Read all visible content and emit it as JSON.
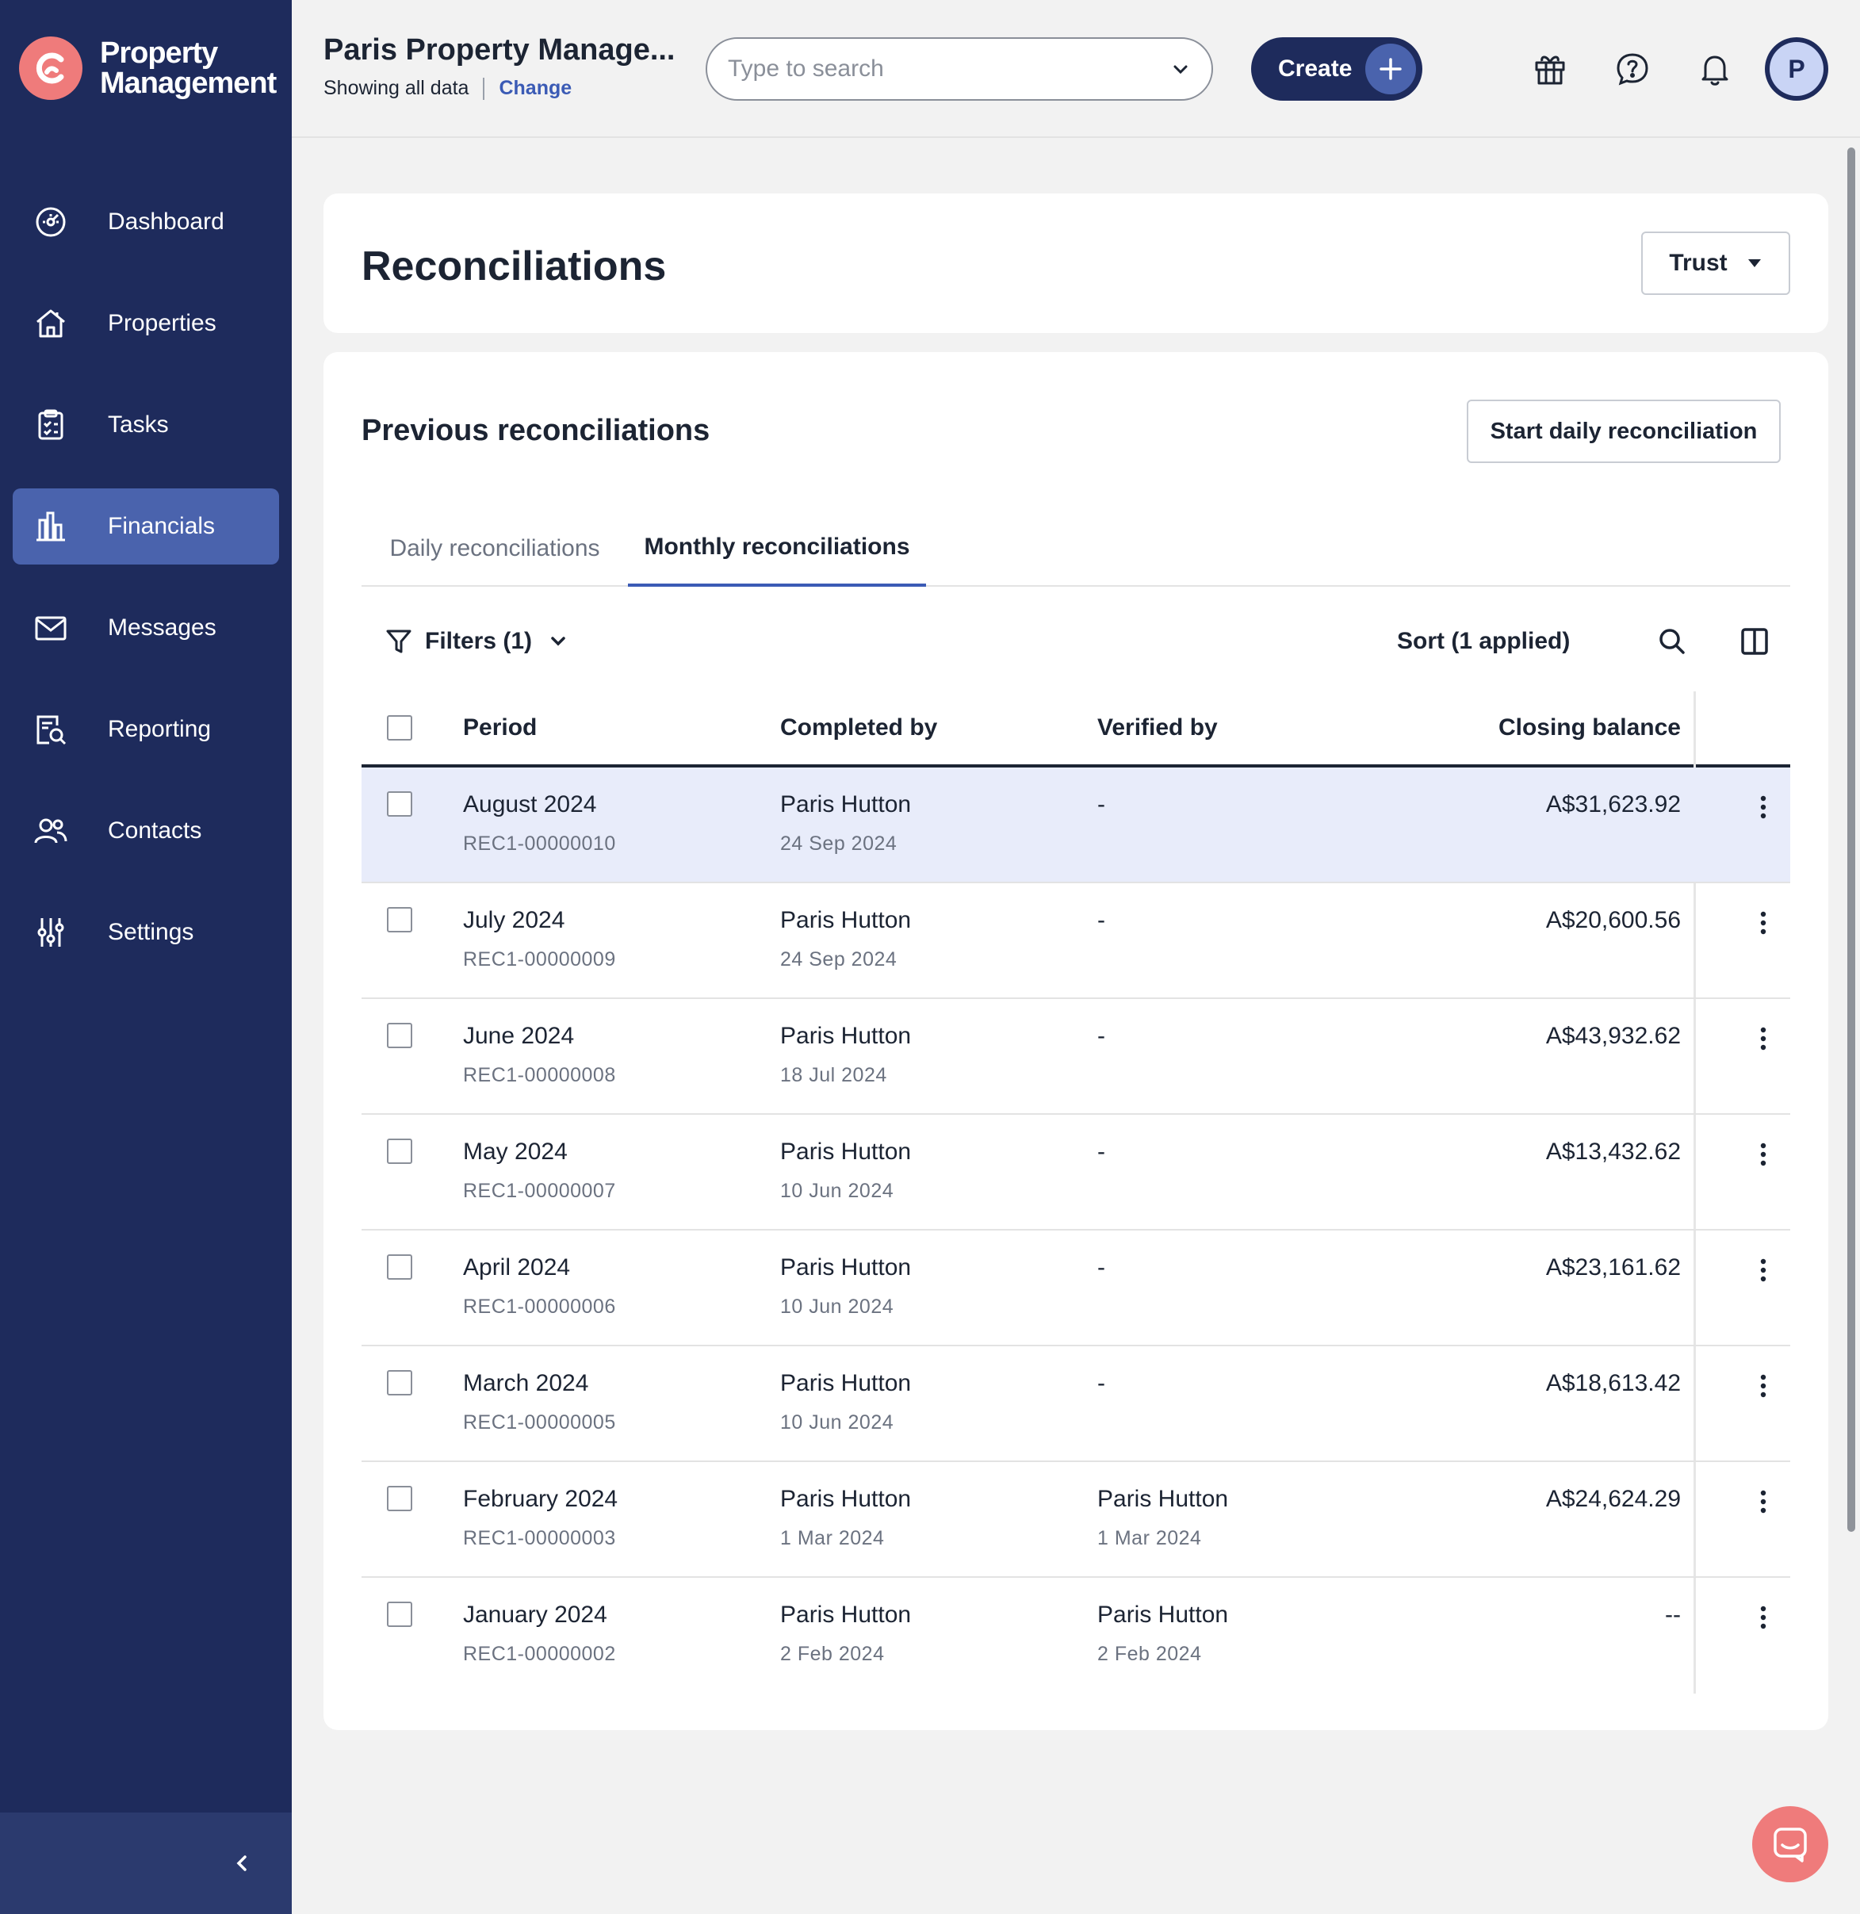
{
  "brand": {
    "name_line1": "Property",
    "name_line2": "Management",
    "accent": "#ef7b7b"
  },
  "colors": {
    "sidebar": "#1e2b5c",
    "active_nav": "#4a63ad",
    "link": "#3b5bb5",
    "selected_row": "#e8ecfa"
  },
  "sidebar": {
    "items": [
      {
        "label": "Dashboard",
        "icon": "dashboard-icon"
      },
      {
        "label": "Properties",
        "icon": "house-icon"
      },
      {
        "label": "Tasks",
        "icon": "clipboard-icon"
      },
      {
        "label": "Financials",
        "icon": "bar-chart-icon",
        "active": true
      },
      {
        "label": "Messages",
        "icon": "envelope-icon"
      },
      {
        "label": "Reporting",
        "icon": "report-search-icon"
      },
      {
        "label": "Contacts",
        "icon": "people-icon"
      },
      {
        "label": "Settings",
        "icon": "sliders-icon"
      }
    ],
    "collapse_icon": "chevron-left-icon"
  },
  "header": {
    "org_title": "Paris Property Manage...",
    "showing": "Showing all data",
    "change_link": "Change",
    "search_placeholder": "Type to search",
    "create_label": "Create",
    "avatar_initial": "P",
    "icons": [
      "gift-icon",
      "help-icon",
      "bell-icon"
    ]
  },
  "page": {
    "title": "Reconciliations",
    "trust_label": "Trust"
  },
  "section": {
    "title": "Previous reconciliations",
    "start_button": "Start daily reconciliation",
    "tabs": [
      {
        "label": "Daily reconciliations",
        "active": false
      },
      {
        "label": "Monthly reconciliations",
        "active": true
      }
    ],
    "filters_label": "Filters (1)",
    "sort_label": "Sort (1 applied)"
  },
  "table": {
    "columns": [
      "Period",
      "Completed by",
      "Verified by",
      "Closing balance"
    ],
    "rows": [
      {
        "period": "August 2024",
        "ref": "REC1-00000010",
        "completed_by": "Paris Hutton",
        "completed_date": "24 Sep 2024",
        "verified_by": "-",
        "verified_date": "",
        "balance": "A$31,623.92",
        "selected": true
      },
      {
        "period": "July 2024",
        "ref": "REC1-00000009",
        "completed_by": "Paris Hutton",
        "completed_date": "24 Sep 2024",
        "verified_by": "-",
        "verified_date": "",
        "balance": "A$20,600.56"
      },
      {
        "period": "June 2024",
        "ref": "REC1-00000008",
        "completed_by": "Paris Hutton",
        "completed_date": "18 Jul 2024",
        "verified_by": "-",
        "verified_date": "",
        "balance": "A$43,932.62"
      },
      {
        "period": "May 2024",
        "ref": "REC1-00000007",
        "completed_by": "Paris Hutton",
        "completed_date": "10 Jun 2024",
        "verified_by": "-",
        "verified_date": "",
        "balance": "A$13,432.62"
      },
      {
        "period": "April 2024",
        "ref": "REC1-00000006",
        "completed_by": "Paris Hutton",
        "completed_date": "10 Jun 2024",
        "verified_by": "-",
        "verified_date": "",
        "balance": "A$23,161.62"
      },
      {
        "period": "March 2024",
        "ref": "REC1-00000005",
        "completed_by": "Paris Hutton",
        "completed_date": "10 Jun 2024",
        "verified_by": "-",
        "verified_date": "",
        "balance": "A$18,613.42"
      },
      {
        "period": "February 2024",
        "ref": "REC1-00000003",
        "completed_by": "Paris Hutton",
        "completed_date": "1 Mar 2024",
        "verified_by": "Paris Hutton",
        "verified_date": "1 Mar 2024",
        "balance": "A$24,624.29"
      },
      {
        "period": "January 2024",
        "ref": "REC1-00000002",
        "completed_by": "Paris Hutton",
        "completed_date": "2 Feb 2024",
        "verified_by": "Paris Hutton",
        "verified_date": "2 Feb 2024",
        "balance": "--"
      }
    ]
  }
}
